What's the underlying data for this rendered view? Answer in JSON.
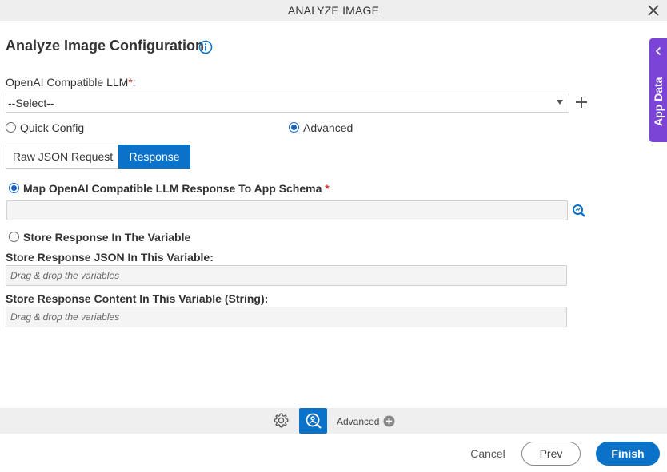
{
  "window": {
    "title": "ANALYZE IMAGE"
  },
  "page": {
    "heading": "Analyze Image Configuration"
  },
  "llm": {
    "label": "OpenAI Compatible LLM",
    "required_mark": "*",
    "colon": ":",
    "selected": "--Select--"
  },
  "mode": {
    "quick_config": "Quick Config",
    "advanced": "Advanced",
    "selected": "Advanced"
  },
  "tabs": [
    {
      "label": "Raw JSON Request",
      "active": false
    },
    {
      "label": "Response",
      "active": true
    }
  ],
  "response": {
    "map_label": "Map OpenAI Compatible LLM Response To App Schema",
    "map_required": "*",
    "map_value": "",
    "store_label": "Store Response In The Variable",
    "json_var_label": "Store Response JSON In This Variable:",
    "json_var_placeholder": "Drag & drop the variables",
    "content_var_label": "Store Response Content In This Variable (String):",
    "content_var_placeholder": "Drag & drop the variables",
    "selected_option": "map"
  },
  "toolbar": {
    "advanced_label": "Advanced"
  },
  "footer": {
    "cancel": "Cancel",
    "prev": "Prev",
    "finish": "Finish"
  },
  "side_panel": {
    "label": "App Data"
  },
  "colors": {
    "accent": "#0a73c9",
    "side_panel": "#7b43d6",
    "required": "#d32f2f"
  },
  "icons": [
    "close-icon",
    "info-icon",
    "chevron-down-icon",
    "plus-icon",
    "search-icon",
    "gear-icon",
    "image-search-icon",
    "plus-circle-icon",
    "chevron-left-icon"
  ]
}
